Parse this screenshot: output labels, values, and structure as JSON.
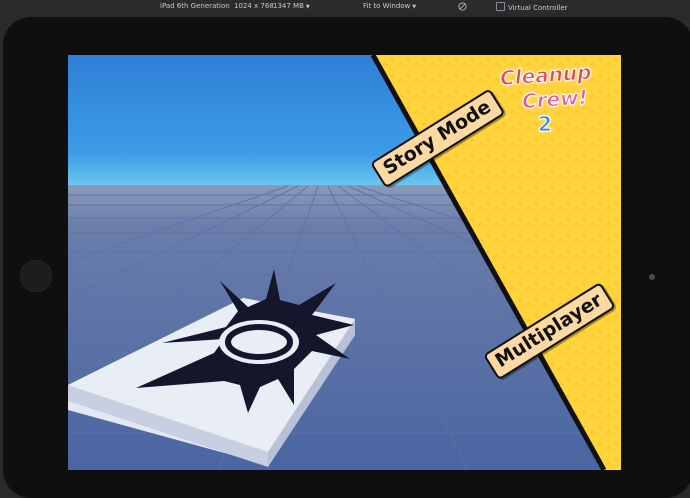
{
  "toolbar": {
    "device": "iPad 6th Generation",
    "resolution": "1024 x 768",
    "memory": "1347 MB",
    "fit": "Fit to Window",
    "virtual_controller": "Virtual Controller"
  },
  "game": {
    "logo_line1": "Cleanup",
    "logo_line2": "Crew!",
    "logo_number": "2",
    "story_label": "Story Mode",
    "multiplayer_label": "Multiplayer",
    "colors": {
      "panel_yellow": "#ffd33c",
      "button_fill": "#fcd9a2",
      "sky_top": "#2f7fd6",
      "sky_horizon": "#6ec8f0",
      "floor": "#4f6aa6"
    }
  }
}
